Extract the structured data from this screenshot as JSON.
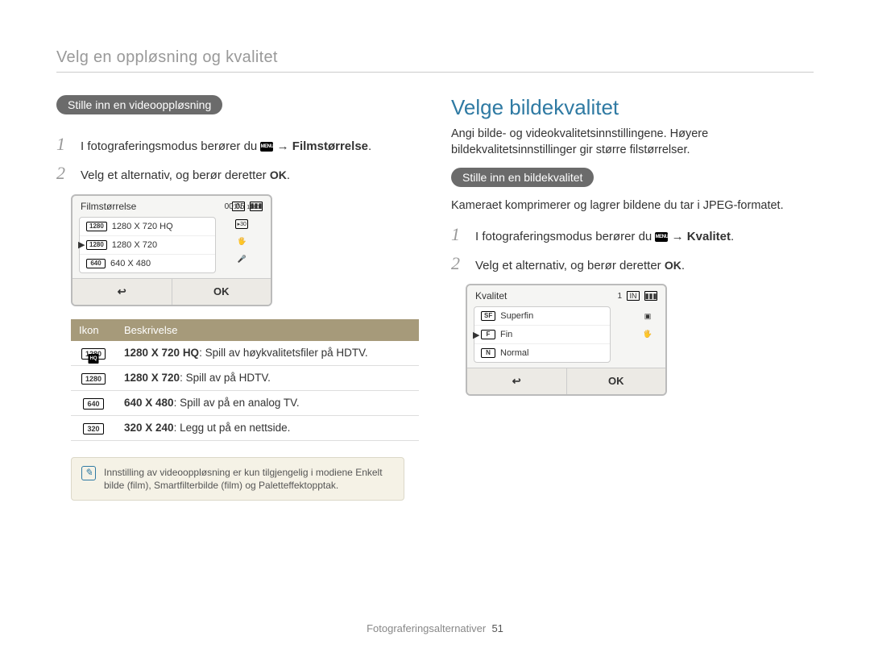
{
  "running_head": "Velg en oppløsning og kvalitet",
  "footer": {
    "section": "Fotograferingsalternativer",
    "page": "51"
  },
  "glyphs": {
    "menu": "MENU",
    "ok": "OK",
    "arrow": "→",
    "back": "↩"
  },
  "left": {
    "pill": "Stille inn en videooppløsning",
    "steps": [
      {
        "num": "1",
        "pre": "I fotograferingsmodus berører du ",
        "post_bold": "Filmstørrelse",
        "suffix": "."
      },
      {
        "num": "2",
        "text": "Velg et alternativ, og berør deretter ",
        "ok": true,
        "suffix": "."
      }
    ],
    "lcd": {
      "title": "Filmstørrelse",
      "timer": "00:05",
      "right_tag": "1280",
      "rows": [
        {
          "badge": "1280",
          "sub": "HQ",
          "label": "1280 X 720 HQ",
          "selected": false
        },
        {
          "badge": "1280",
          "label": "1280 X 720",
          "selected": true
        },
        {
          "badge": "640",
          "label": "640 X 480",
          "selected": false
        }
      ],
      "status_icons": [
        "IN",
        "batt",
        "1280/30",
        "HD",
        "mic"
      ],
      "back": "↩",
      "ok": "OK"
    },
    "table": {
      "head": [
        "Ikon",
        "Beskrivelse"
      ],
      "rows": [
        {
          "badge": "1280",
          "hq": true,
          "bold": "1280 X 720 HQ",
          "rest": ": Spill av høykvalitetsfiler på HDTV."
        },
        {
          "badge": "1280",
          "hq": false,
          "bold": "1280 X 720",
          "rest": ": Spill av på HDTV."
        },
        {
          "badge": "640",
          "hq": false,
          "bold": "640 X 480",
          "rest": ": Spill av på en analog TV."
        },
        {
          "badge": "320",
          "hq": false,
          "bold": "320 X 240",
          "rest": ": Legg ut på en nettside."
        }
      ]
    },
    "note": "Innstilling av videooppløsning er kun tilgjengelig i modiene Enkelt bilde (film), Smartfilterbilde (film) og Paletteffektopptak."
  },
  "right": {
    "title": "Velge bildekvalitet",
    "intro": "Angi bilde- og videokvalitetsinnstillingene. Høyere bildekvalitetsinnstillinger gir større filstørrelser.",
    "pill": "Stille inn en bildekvalitet",
    "para2": "Kameraet komprimerer og lagrer bildene du tar i JPEG-formatet.",
    "steps": [
      {
        "num": "1",
        "pre": "I fotograferingsmodus berører du ",
        "post_bold": "Kvalitet",
        "suffix": "."
      },
      {
        "num": "2",
        "text": "Velg et alternativ, og berør deretter ",
        "ok": true,
        "suffix": "."
      }
    ],
    "lcd": {
      "title": "Kvalitet",
      "count": "1",
      "rows": [
        {
          "icon": "SF",
          "label": "Superfin",
          "selected": false
        },
        {
          "icon": "F",
          "label": "Fin",
          "selected": true
        },
        {
          "icon": "N",
          "label": "Normal",
          "selected": false
        }
      ],
      "back": "↩",
      "ok": "OK"
    }
  }
}
